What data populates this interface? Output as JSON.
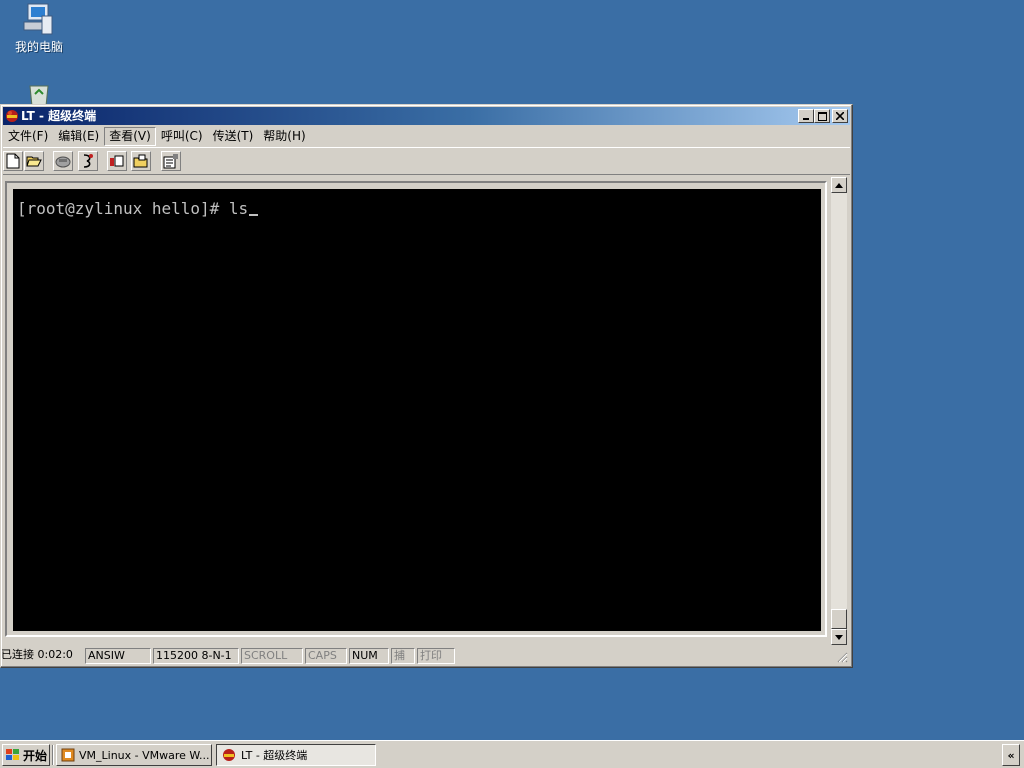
{
  "desktop": {
    "icons": [
      {
        "label": "我的电脑",
        "icon": "my-computer-icon"
      },
      {
        "label": "",
        "icon": "recycle-bin-icon"
      }
    ]
  },
  "window": {
    "title": "LT - 超级终端",
    "menu": [
      "文件(F)",
      "编辑(E)",
      "查看(V)",
      "呼叫(C)",
      "传送(T)",
      "帮助(H)"
    ],
    "active_menu_index": 2,
    "toolbar_icons": [
      "new-icon",
      "open-icon",
      "disconnect-icon",
      "call-icon",
      "send-icon",
      "receive-icon",
      "properties-icon"
    ]
  },
  "terminal": {
    "line": "[root@zylinux hello]# ls"
  },
  "statusbar": {
    "connected": "已连接 0:02:0",
    "emulation": "ANSIW",
    "port_settings": "115200 8-N-1",
    "scroll": "SCROLL",
    "caps": "CAPS",
    "num": "NUM",
    "capture": "捕",
    "print": "打印"
  },
  "taskbar": {
    "start_label": "开始",
    "tasks": [
      {
        "label": "VM_Linux - VMware W...",
        "active": false
      },
      {
        "label": "LT - 超级终端",
        "active": true
      }
    ],
    "tray_toggle": "«"
  },
  "colors": {
    "desktop": "#3a6ea5",
    "title_start": "#0a246a",
    "title_end": "#a6caf0",
    "chrome": "#d4d0c8",
    "terminal_bg": "#000000",
    "terminal_fg": "#c0c0c0"
  }
}
